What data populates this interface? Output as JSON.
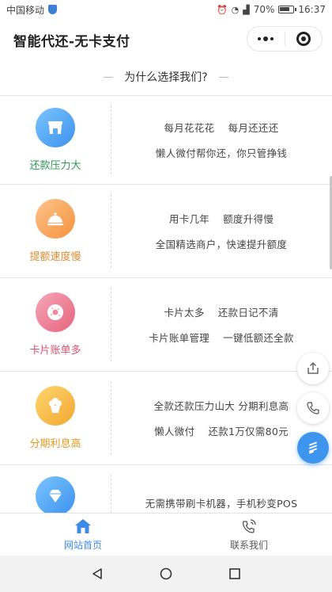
{
  "status_bar": {
    "carrier": "中国移动",
    "battery": "70%",
    "time": "16:37",
    "wifi_label": "4G"
  },
  "title_bar": {
    "title": "智能代还-无卡支付"
  },
  "section": {
    "title": "为什么选择我们?"
  },
  "features": [
    {
      "category": "还款压力大",
      "line1": "每月花花花    每月还还还",
      "line2": "懒人微付帮你还，你只管挣钱",
      "icon": "store-icon",
      "color": "#2f9a55"
    },
    {
      "category": "提额速度慢",
      "line1": "用卡几年    额度升得慢",
      "line2": "全国精选商户，快速提升额度",
      "icon": "cloche-icon",
      "color": "#e08a2e"
    },
    {
      "category": "卡片账单多",
      "line1": "卡片太多    还款日记不清",
      "line2": "卡片账单管理    一键低额还全款",
      "icon": "donut-icon",
      "color": "#d9536f"
    },
    {
      "category": "分期利息高",
      "line1": "全款还款压力山大 分期利息高",
      "line2": "懒人微付    还款1万仅需80元",
      "icon": "cupcake-icon",
      "color": "#e39a22"
    },
    {
      "category": "",
      "line1": "无需携带刷卡机器，手机秒变POS",
      "line2": "",
      "icon": "diamond-icon",
      "color": "#3d92ee"
    }
  ],
  "tab_bar": {
    "home_label": "网站首页",
    "contact_label": "联系我们"
  },
  "colors": {
    "accent": "#3d8ae8"
  }
}
